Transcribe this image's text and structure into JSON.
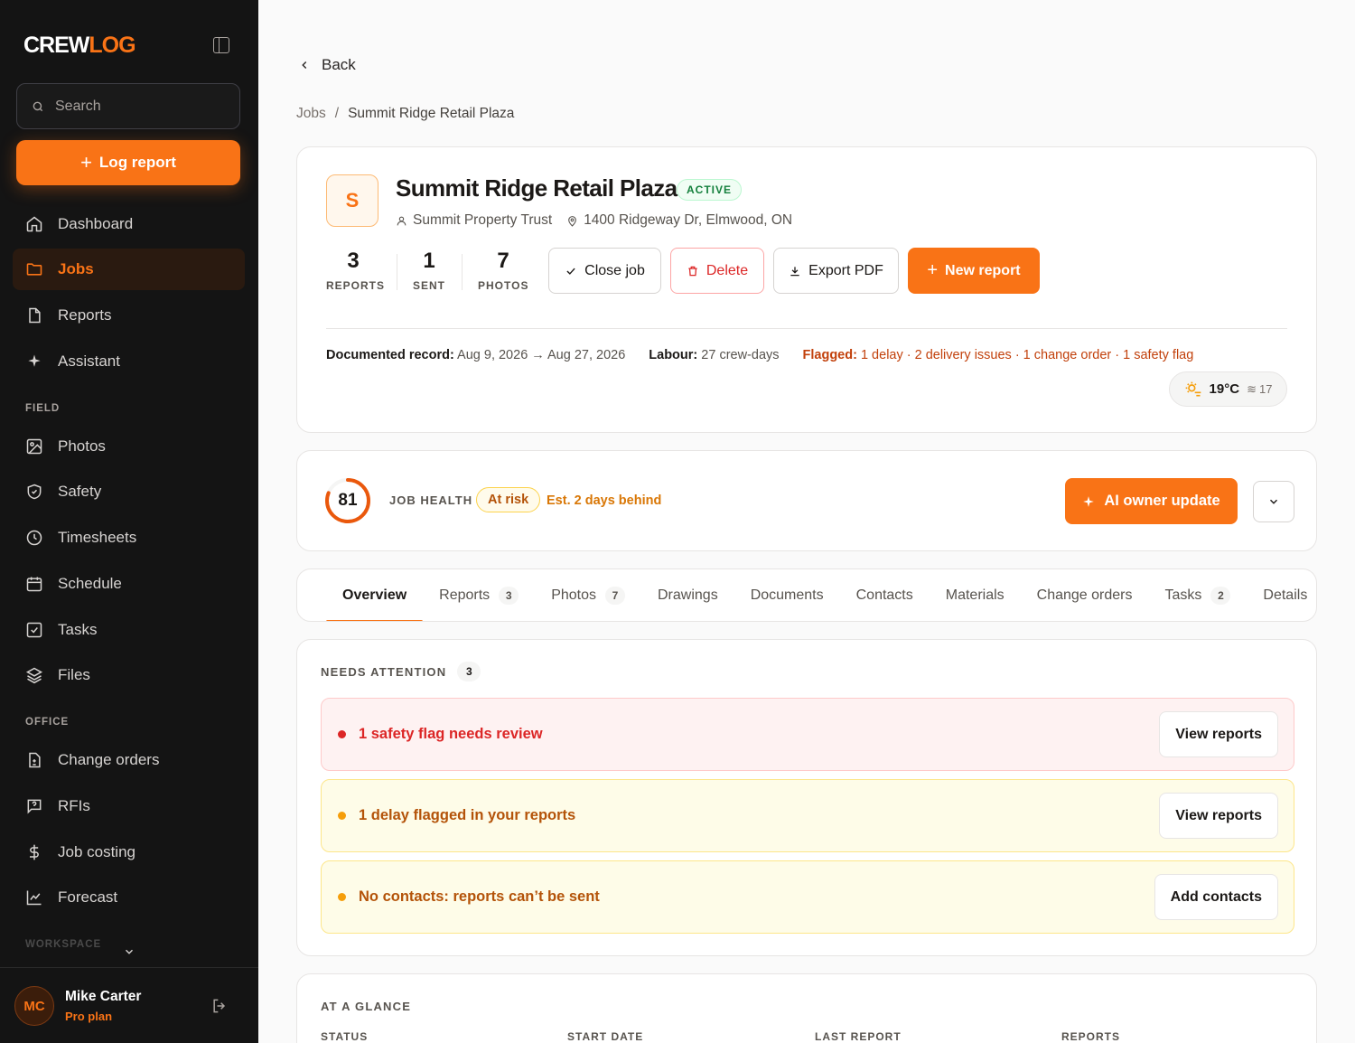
{
  "brand": {
    "part1": "CREW",
    "part2": "LOG"
  },
  "sidebar": {
    "search_placeholder": "Search",
    "log_report_label": "Log report",
    "main_items": [
      {
        "label": "Dashboard",
        "icon": "home-icon"
      },
      {
        "label": "Jobs",
        "icon": "folder-icon",
        "active": true
      },
      {
        "label": "Reports",
        "icon": "file-icon"
      },
      {
        "label": "Assistant",
        "icon": "sparkle-icon"
      }
    ],
    "field_section": "FIELD",
    "field_items": [
      {
        "label": "Photos",
        "icon": "image-icon"
      },
      {
        "label": "Safety",
        "icon": "shield-icon"
      },
      {
        "label": "Timesheets",
        "icon": "clock-icon"
      },
      {
        "label": "Schedule",
        "icon": "calendar-icon"
      },
      {
        "label": "Tasks",
        "icon": "checkbox-icon"
      },
      {
        "label": "Files",
        "icon": "layers-icon"
      }
    ],
    "office_section": "OFFICE",
    "office_items": [
      {
        "label": "Change orders",
        "icon": "file-diff-icon"
      },
      {
        "label": "RFIs",
        "icon": "message-question-icon"
      },
      {
        "label": "Job costing",
        "icon": "dollar-icon"
      },
      {
        "label": "Forecast",
        "icon": "chart-line-icon"
      }
    ],
    "workspace_section": "WORKSPACE",
    "user": {
      "initials": "MC",
      "name": "Mike Carter",
      "plan": "Pro plan"
    }
  },
  "nav": {
    "back_label": "Back",
    "breadcrumb": [
      "Jobs",
      "Summit Ridge Retail Plaza"
    ],
    "breadcrumb_sep": "/"
  },
  "job": {
    "initial": "S",
    "title": "Summit Ridge Retail Plaza",
    "status": "ACTIVE",
    "client": "Summit Property Trust",
    "address": "1400 Ridgeway Dr, Elmwood, ON",
    "stats": [
      {
        "value": "3",
        "label": "REPORTS"
      },
      {
        "value": "1",
        "label": "SENT"
      },
      {
        "value": "7",
        "label": "PHOTOS"
      }
    ],
    "actions": {
      "close": "Close job",
      "delete": "Delete",
      "export": "Export PDF",
      "new_report": "New report"
    },
    "record_label": "Documented record:",
    "record_value": "Aug 9, 2026 → Aug 27, 2026",
    "labour_label": "Labour:",
    "labour_value": "27 crew-days",
    "flagged_label": "Flagged:",
    "flagged_value": "1 delay · 2 delivery issues · 1 change order · 1 safety flag",
    "weather": {
      "temp": "19°C",
      "wind": "17"
    }
  },
  "health": {
    "score": 81,
    "label": "JOB HEALTH",
    "status": "At risk",
    "estimate": "Est. 2 days behind",
    "ai_button": "AI owner update"
  },
  "tabs": [
    {
      "label": "Overview",
      "active": true
    },
    {
      "label": "Reports",
      "count": "3"
    },
    {
      "label": "Photos",
      "count": "7"
    },
    {
      "label": "Drawings"
    },
    {
      "label": "Documents"
    },
    {
      "label": "Contacts"
    },
    {
      "label": "Materials"
    },
    {
      "label": "Change orders"
    },
    {
      "label": "Tasks",
      "count": "2"
    },
    {
      "label": "Details"
    }
  ],
  "attention": {
    "title": "NEEDS ATTENTION",
    "count": "3",
    "items": [
      {
        "text": "1 safety flag needs review",
        "action": "View reports",
        "severity": "red"
      },
      {
        "text": "1 delay flagged in your reports",
        "action": "View reports",
        "severity": "amber"
      },
      {
        "text": "No contacts: reports can’t be sent",
        "action": "Add contacts",
        "severity": "amber"
      }
    ]
  },
  "glance": {
    "title": "AT A GLANCE",
    "columns": [
      "STATUS",
      "START DATE",
      "LAST REPORT",
      "REPORTS"
    ]
  },
  "colors": {
    "accent": "#f97316",
    "sidebar_bg": "#141414",
    "danger": "#dc2626",
    "warning": "#d97706",
    "success": "#15803d"
  }
}
